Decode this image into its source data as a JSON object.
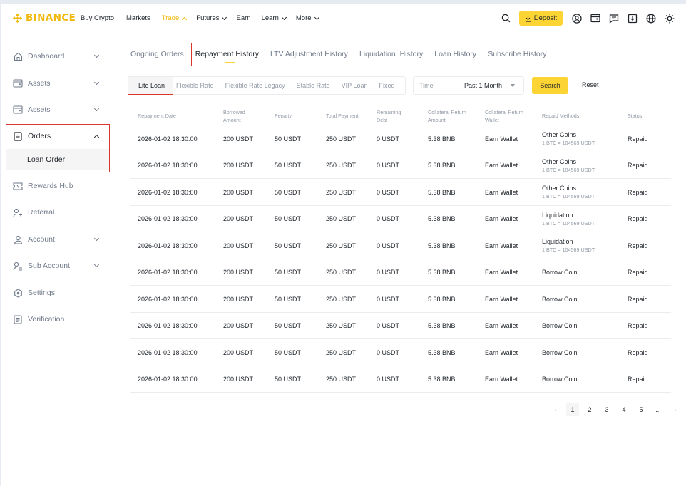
{
  "header": {
    "brand": "BINANCE",
    "nav": [
      {
        "label": "Buy Crypto",
        "dropdown": false
      },
      {
        "label": "Markets",
        "dropdown": false
      },
      {
        "label": "Trade",
        "dropdown": true,
        "active": true
      },
      {
        "label": "Futures",
        "dropdown": true
      },
      {
        "label": "Earn",
        "dropdown": false
      },
      {
        "label": "Learn",
        "dropdown": true
      },
      {
        "label": "More",
        "dropdown": true
      }
    ],
    "deposit_label": "Deposit",
    "icons": [
      "search-icon",
      "profile-icon",
      "wallet-icon",
      "messages-icon",
      "download-icon",
      "globe-icon",
      "theme-icon"
    ]
  },
  "sidebar": {
    "items": [
      {
        "label": "Dashboard",
        "icon": "home-icon",
        "chevron": true
      },
      {
        "label": "Assets",
        "icon": "wallet-icon",
        "chevron": true
      },
      {
        "label": "Assets",
        "icon": "wallet-icon",
        "chevron": true
      },
      {
        "label": "Orders",
        "icon": "orders-icon",
        "chevron": true,
        "expanded": true
      },
      {
        "label": "Rewards Hub",
        "icon": "ticket-icon",
        "chevron": false
      },
      {
        "label": "Referral",
        "icon": "add-user-icon",
        "chevron": false
      },
      {
        "label": "Account",
        "icon": "user-icon",
        "chevron": true
      },
      {
        "label": "Sub Account",
        "icon": "sub-account-icon",
        "chevron": true
      },
      {
        "label": "Settings",
        "icon": "settings-icon",
        "chevron": false
      },
      {
        "label": "Verification",
        "icon": "document-icon",
        "chevron": false
      }
    ],
    "sub_item": "Loan Order"
  },
  "tabs": [
    "Ongoing Orders",
    "Repayment History",
    "LTV Adjustment History",
    "Liquidation  History",
    "Loan History",
    "Subscribe History"
  ],
  "active_tab": "Repayment History",
  "filters": {
    "loan_types": [
      "Lite Loan",
      "Flexible Rate",
      "Flexible Rate Legacy",
      "Stable Rate",
      "VIP Loan",
      "Fixed"
    ],
    "active_loan_type": "Lite Loan",
    "time_label": "Time",
    "time_value": "Past 1 Month",
    "search_label": "Search",
    "reset_label": "Reset"
  },
  "table": {
    "columns": [
      [
        "Repayment Date"
      ],
      [
        "Borrowed",
        "Amount"
      ],
      [
        "Penalty"
      ],
      [
        "Total Payment"
      ],
      [
        "Remaining",
        "Debt"
      ],
      [
        "Collateral Return",
        "Amount"
      ],
      [
        "Collateral Return",
        "Wallet"
      ],
      [
        "Repaid Methods"
      ],
      [
        "Status"
      ]
    ],
    "rows": [
      {
        "date": "2026-01-02 18:30:00",
        "borrowed": "200 USDT",
        "penalty": "50 USDT",
        "total": "250 USDT",
        "remaining": "0 USDT",
        "collateral_amount": "5.38 BNB",
        "wallet": "Earn Wallet",
        "method": "Other Coins",
        "method_sub": "1 BTC = 104569 USDT",
        "status": "Repaid"
      },
      {
        "date": "2026-01-02 18:30:00",
        "borrowed": "200 USDT",
        "penalty": "50 USDT",
        "total": "250 USDT",
        "remaining": "0 USDT",
        "collateral_amount": "5.38 BNB",
        "wallet": "Earn Wallet",
        "method": "Other Coins",
        "method_sub": "1 BTC = 104569 USDT",
        "status": "Repaid"
      },
      {
        "date": "2026-01-02 18:30:00",
        "borrowed": "200 USDT",
        "penalty": "50 USDT",
        "total": "250 USDT",
        "remaining": "0 USDT",
        "collateral_amount": "5.38 BNB",
        "wallet": "Earn Wallet",
        "method": "Other Coins",
        "method_sub": "1 BTC = 104569 USDT",
        "status": "Repaid"
      },
      {
        "date": "2026-01-02 18:30:00",
        "borrowed": "200 USDT",
        "penalty": "50 USDT",
        "total": "250 USDT",
        "remaining": "0 USDT",
        "collateral_amount": "5.38 BNB",
        "wallet": "Earn Wallet",
        "method": "Liquidation",
        "method_sub": "1 BTC = 104569 USDT",
        "status": "Repaid"
      },
      {
        "date": "2026-01-02 18:30:00",
        "borrowed": "200 USDT",
        "penalty": "50 USDT",
        "total": "250 USDT",
        "remaining": "0 USDT",
        "collateral_amount": "5.38 BNB",
        "wallet": "Earn Wallet",
        "method": "Liquidation",
        "method_sub": "1 BTC = 104569 USDT",
        "status": "Repaid"
      },
      {
        "date": "2026-01-02 18:30:00",
        "borrowed": "200 USDT",
        "penalty": "50 USDT",
        "total": "250 USDT",
        "remaining": "0 USDT",
        "collateral_amount": "5.38 BNB",
        "wallet": "Earn Wallet",
        "method": "Borrow Coin",
        "method_sub": "",
        "status": "Repaid"
      },
      {
        "date": "2026-01-02 18:30:00",
        "borrowed": "200 USDT",
        "penalty": "50 USDT",
        "total": "250 USDT",
        "remaining": "0 USDT",
        "collateral_amount": "5.38 BNB",
        "wallet": "Earn Wallet",
        "method": "Borrow Coin",
        "method_sub": "",
        "status": "Repaid"
      },
      {
        "date": "2026-01-02 18:30:00",
        "borrowed": "200 USDT",
        "penalty": "50 USDT",
        "total": "250 USDT",
        "remaining": "0 USDT",
        "collateral_amount": "5.38 BNB",
        "wallet": "Earn Wallet",
        "method": "Borrow Coin",
        "method_sub": "",
        "status": "Repaid"
      },
      {
        "date": "2026-01-02 18:30:00",
        "borrowed": "200 USDT",
        "penalty": "50 USDT",
        "total": "250 USDT",
        "remaining": "0 USDT",
        "collateral_amount": "5.38 BNB",
        "wallet": "Earn Wallet",
        "method": "Borrow Coin",
        "method_sub": "",
        "status": "Repaid"
      },
      {
        "date": "2026-01-02 18:30:00",
        "borrowed": "200 USDT",
        "penalty": "50 USDT",
        "total": "250 USDT",
        "remaining": "0 USDT",
        "collateral_amount": "5.38 BNB",
        "wallet": "Earn Wallet",
        "method": "Borrow Coin",
        "method_sub": "",
        "status": "Repaid"
      }
    ]
  },
  "pagination": {
    "pages": [
      "1",
      "2",
      "3",
      "4",
      "5"
    ],
    "current": "1",
    "ellipsis": "..."
  },
  "colors": {
    "brand": "#f0b90b",
    "accent": "#fcd535",
    "highlight_border": "#d8382a",
    "muted_text": "#929aa5"
  }
}
